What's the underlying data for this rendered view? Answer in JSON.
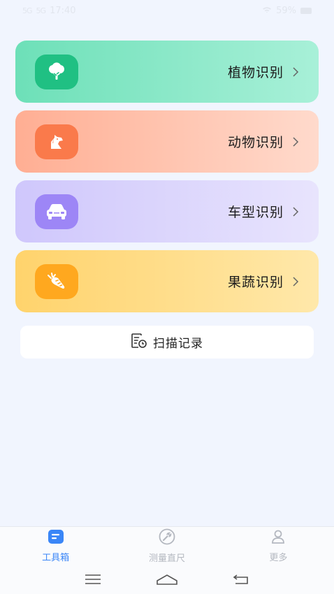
{
  "status": {
    "signal": "5G",
    "signal2": "5G",
    "time": "17:40",
    "battery": "59%"
  },
  "cards": [
    {
      "label": "植物识别",
      "icon": "tree-icon"
    },
    {
      "label": "动物识别",
      "icon": "dog-icon"
    },
    {
      "label": "车型识别",
      "icon": "car-icon"
    },
    {
      "label": "果蔬识别",
      "icon": "carrot-icon"
    }
  ],
  "scan_record": {
    "label": "扫描记录",
    "icon": "record-clock-icon"
  },
  "tabs": [
    {
      "label": "工具箱",
      "icon": "toolbox-icon",
      "active": true
    },
    {
      "label": "测量直尺",
      "icon": "wrench-circle-icon",
      "active": false
    },
    {
      "label": "更多",
      "icon": "person-icon",
      "active": false
    }
  ],
  "colors": {
    "plant": "#20c083",
    "animal": "#fa7a4b",
    "car": "#9d86f6",
    "fruit": "#ffa81f",
    "active_tab": "#3a86f7"
  }
}
